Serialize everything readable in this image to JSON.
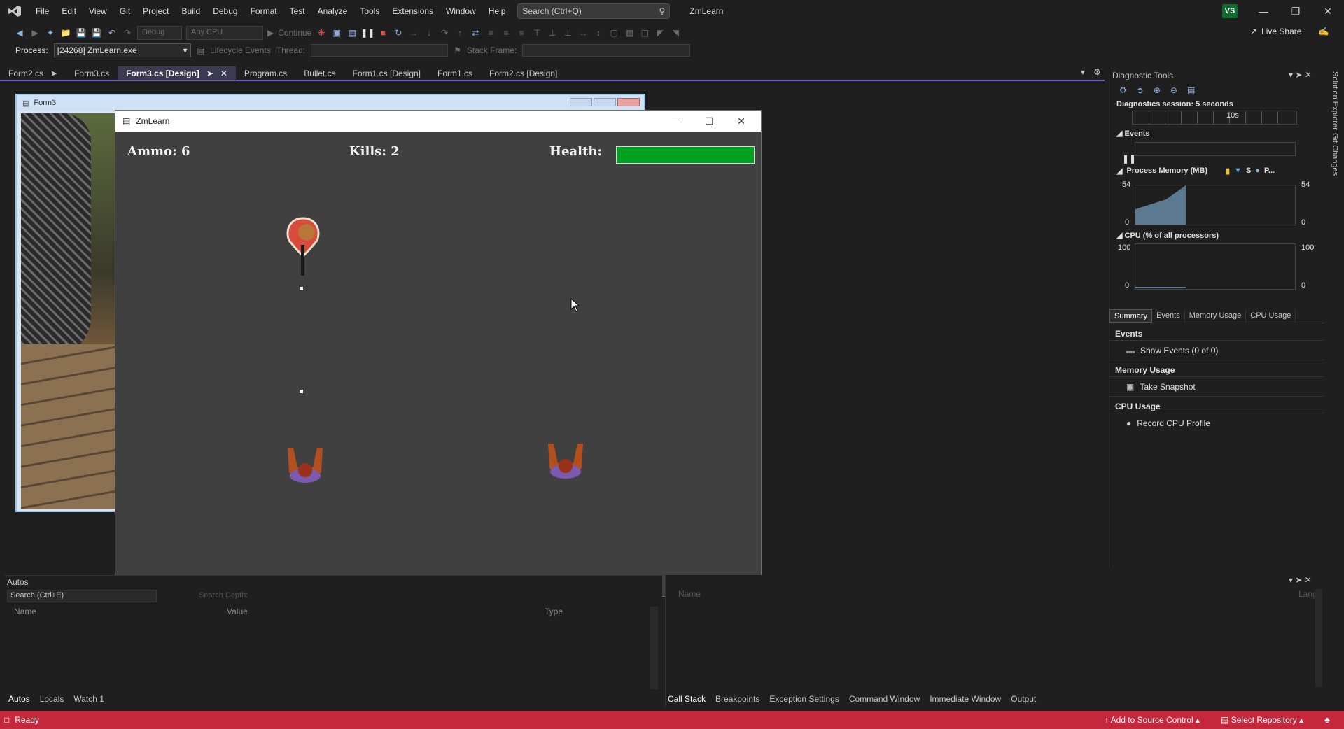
{
  "menubar": {
    "items": [
      "File",
      "Edit",
      "View",
      "Git",
      "Project",
      "Build",
      "Debug",
      "Format",
      "Test",
      "Analyze",
      "Tools",
      "Extensions",
      "Window",
      "Help"
    ],
    "search_placeholder": "Search (Ctrl+Q)",
    "app_title": "ZmLearn",
    "account_initials": "VS"
  },
  "toolbar": {
    "config": "Debug",
    "platform": "Any CPU",
    "continue_label": "Continue",
    "live_share": "Live Share",
    "process_label": "Process:",
    "process_value": "[24268] ZmLearn.exe",
    "lifecycle_label": "Lifecycle Events",
    "thread_label": "Thread:",
    "stack_frame_label": "Stack Frame:"
  },
  "doc_tabs": [
    "Form2.cs",
    "Form3.cs",
    "Form3.cs [Design]",
    "Program.cs",
    "Bullet.cs",
    "Form1.cs [Design]",
    "Form1.cs",
    "Form2.cs [Design]"
  ],
  "active_tab": "Form3.cs [Design]",
  "form3": {
    "title": "Form3"
  },
  "game": {
    "title": "ZmLearn",
    "ammo": "Ammo: 6",
    "kills": "Kills: 2",
    "health_label": "Health:",
    "health_level": 1.0,
    "health_color": "#00a020"
  },
  "autos": {
    "title": "Autos",
    "search_placeholder": "Search (Ctrl+E)",
    "search_depth": "Search Depth:",
    "columns": [
      "Name",
      "Value",
      "Type"
    ],
    "tabs": [
      "Autos",
      "Locals",
      "Watch 1"
    ]
  },
  "callstack": {
    "header_name": "Name",
    "header_lang": "Lang",
    "tabs": [
      "Call Stack",
      "Breakpoints",
      "Exception Settings",
      "Command Window",
      "Immediate Window",
      "Output"
    ]
  },
  "diagnostics": {
    "title": "Diagnostic Tools",
    "session": "Diagnostics session: 5 seconds",
    "ruler_label": "10s",
    "events_label": "Events",
    "memory_label": "Process Memory (MB)",
    "memory_legend": [
      "S",
      "P..."
    ],
    "memory_max": "54",
    "memory_min": "0",
    "cpu_label": "CPU (% of all processors)",
    "cpu_max": "100",
    "cpu_min": "0",
    "tabs": [
      "Summary",
      "Events",
      "Memory Usage",
      "CPU Usage"
    ],
    "sections": {
      "events": "Events",
      "show_events": "Show Events (0 of 0)",
      "memory_usage": "Memory Usage",
      "take_snapshot": "Take Snapshot",
      "cpu_usage": "CPU Usage",
      "record_cpu": "Record CPU Profile"
    }
  },
  "side_strip": [
    "Solution Explorer",
    "Git Changes"
  ],
  "status": {
    "ready": "Ready",
    "source_control": "Add to Source Control",
    "repository": "Select Repository"
  },
  "colors": {
    "accent": "#6c5fc7",
    "status_bar": "#c5283d"
  }
}
